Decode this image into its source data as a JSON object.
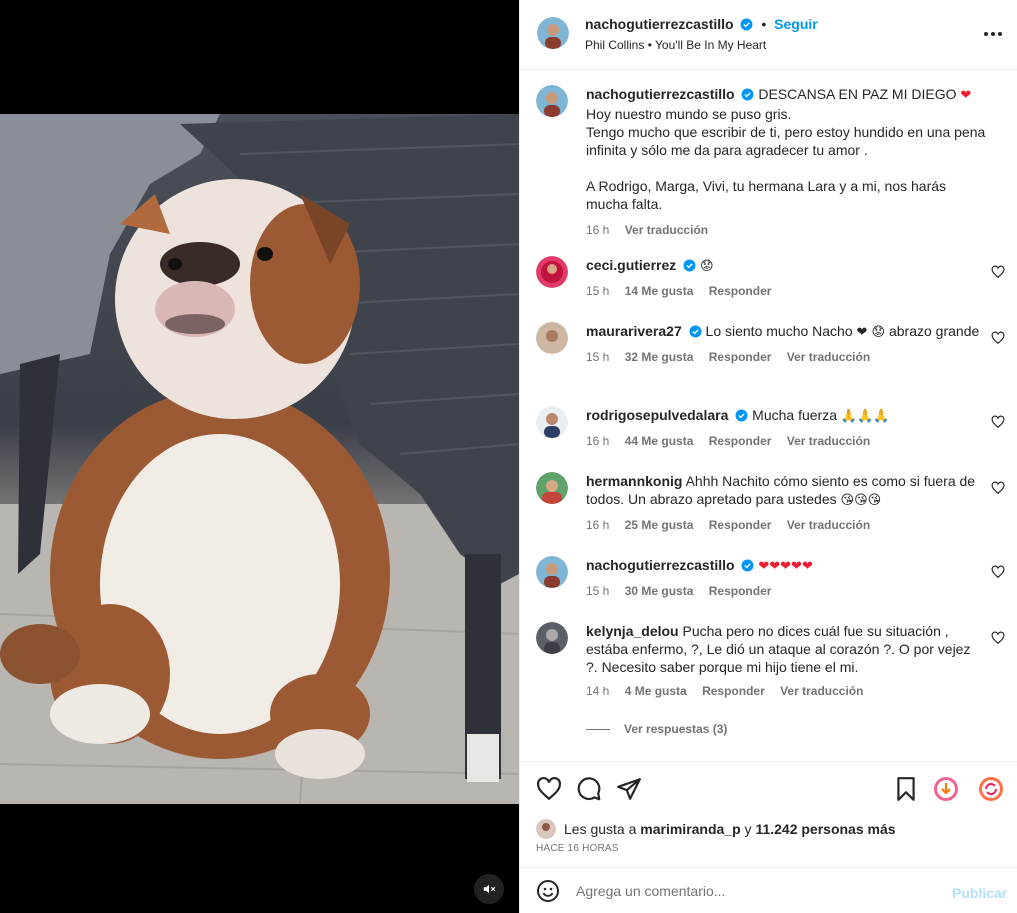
{
  "post": {
    "author": "nachogutierrezcastillo",
    "follow_label": "Seguir",
    "audio_artist": "Phil Collins",
    "audio_sep": "•",
    "audio_title": "You'll Be In My Heart",
    "caption_title": "DESCANSA EN PAZ MI DIEGO",
    "caption_lines": [
      "Hoy nuestro mundo se puso gris.",
      "Tengo mucho que escribir de ti, pero estoy hundido en una pena infinita y sólo me da para agradecer tu amor .",
      "A Rodrigo, Marga, Vivi, tu hermana Lara y a mi, nos harás mucha falta."
    ],
    "caption_time": "16 h",
    "caption_translate": "Ver traducción"
  },
  "comments": [
    {
      "user": "ceci.gutierrez",
      "verified": true,
      "text": "",
      "emoji": "😟",
      "time": "15 h",
      "likes": "14 Me gusta",
      "reply": "Responder",
      "translate": ""
    },
    {
      "user": "maurarivera27",
      "verified": true,
      "text": "Lo siento mucho Nacho",
      "emoji": "❤ 😟",
      "text2": "abrazo grande",
      "time": "15 h",
      "likes": "32 Me gusta",
      "reply": "Responder",
      "translate": "Ver traducción"
    },
    {
      "user": "rodrigosepulvedalara",
      "verified": true,
      "text": "Mucha fuerza",
      "emoji": "🙏🙏🙏",
      "time": "16 h",
      "likes": "44 Me gusta",
      "reply": "Responder",
      "translate": "Ver traducción"
    },
    {
      "user": "hermannkonig",
      "verified": false,
      "text": "Ahhh Nachito cómo siento es como si fuera de todos. Un abrazo apretado para ustedes",
      "emoji": "😘😘😘",
      "time": "16 h",
      "likes": "25 Me gusta",
      "reply": "Responder",
      "translate": "Ver traducción"
    },
    {
      "user": "nachogutierrezcastillo",
      "verified": true,
      "text": "",
      "emoji": "❤❤❤❤❤",
      "time": "15 h",
      "likes": "30 Me gusta",
      "reply": "Responder",
      "translate": ""
    },
    {
      "user": "kelynja_delou",
      "verified": false,
      "text": "Pucha pero no dices cuál fue su situación , estába enfermo, ?, Le dió un ataque al corazón ?. O por vejez ?. Necesito saber porque mi hijo tiene el mi.",
      "emoji": "",
      "time": "14 h",
      "likes": "4 Me gusta",
      "reply": "Responder",
      "translate": "Ver traducción"
    }
  ],
  "view_replies": "Ver respuestas (3)",
  "likes_line": {
    "prefix": "Les gusta a",
    "user": "marimiranda_p",
    "mid": "y",
    "count": "11.242 personas más"
  },
  "time_ago": "HACE 16 HORAS",
  "comment_box": {
    "placeholder": "Agrega un comentario...",
    "publish": "Publicar"
  },
  "colors": {
    "accent": "#0095f6",
    "verified": "#0095f6",
    "heart": "#ed1c2e",
    "muted": "#737373"
  }
}
